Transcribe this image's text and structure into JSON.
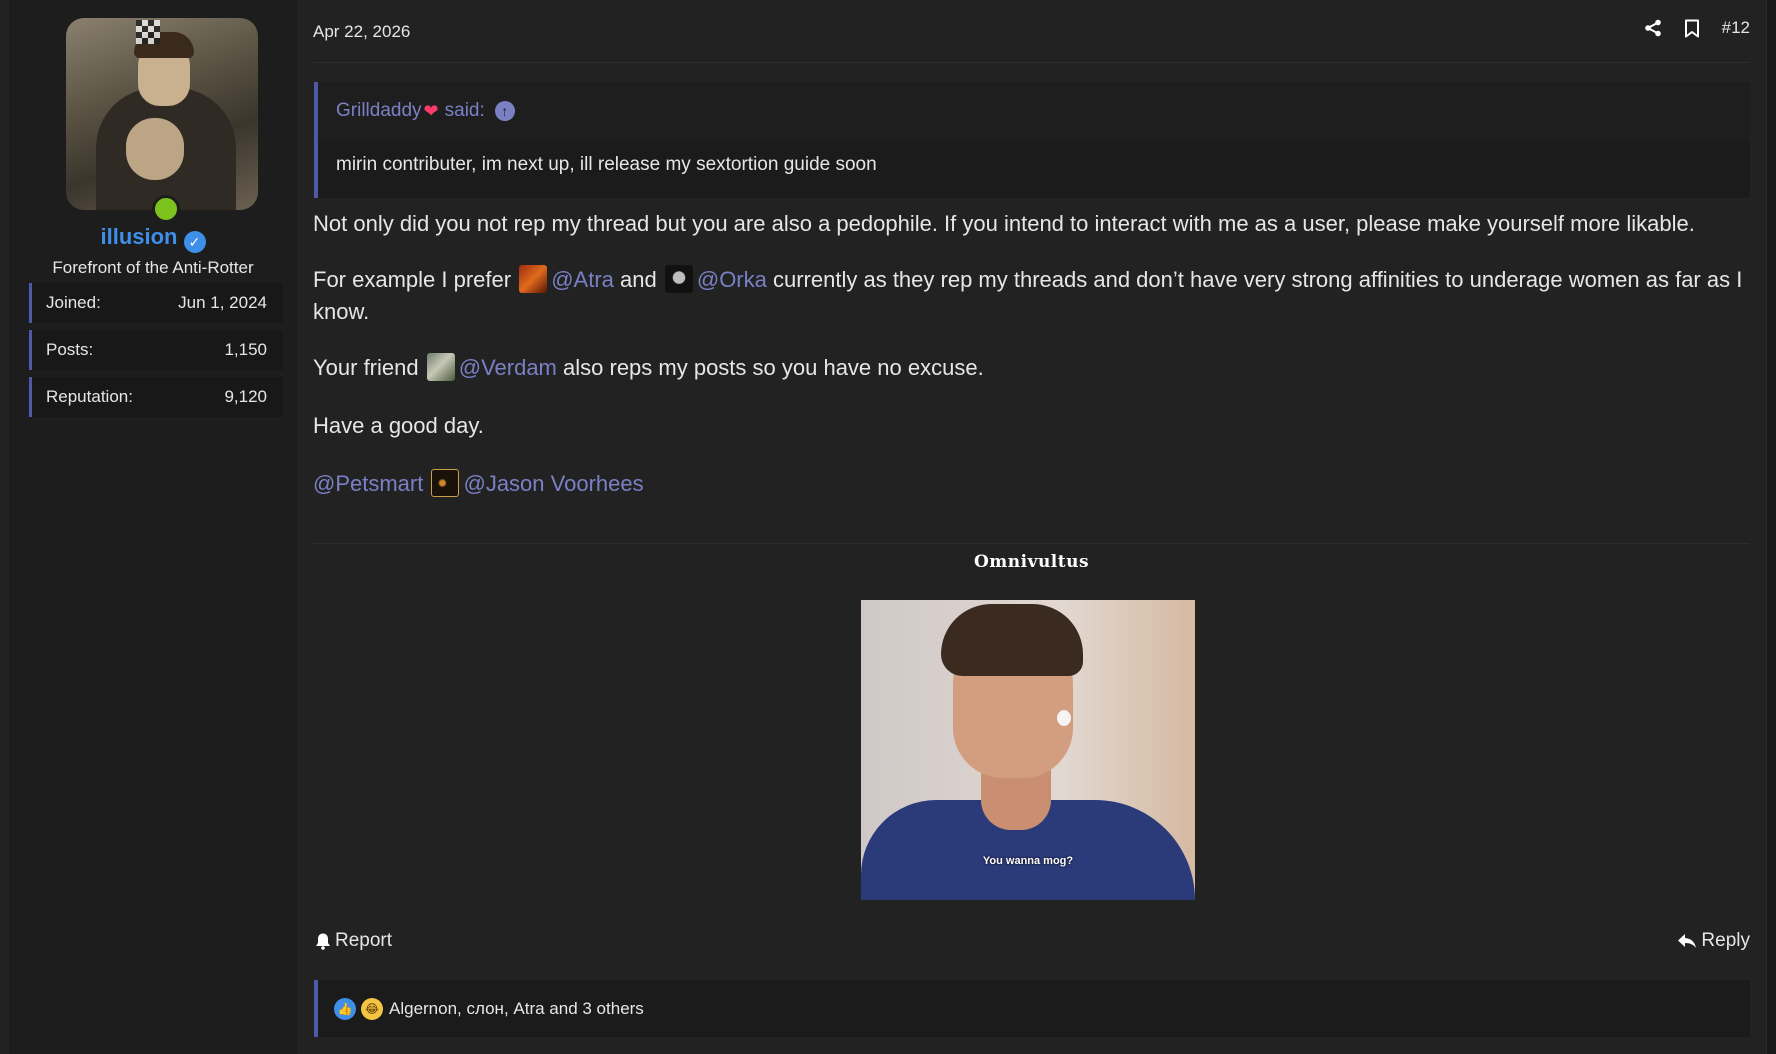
{
  "user": {
    "name": "illusion",
    "title": "Forefront of the Anti-Rotter Movement",
    "status": "online",
    "stats": [
      {
        "label": "Joined:",
        "value": "Jun 1, 2024"
      },
      {
        "label": "Posts:",
        "value": "1,150"
      },
      {
        "label": "Reputation:",
        "value": "9,120"
      }
    ]
  },
  "post": {
    "date": "Apr 22, 2026",
    "number": "#12",
    "quote": {
      "author": "Grilldaddy",
      "said_label": "said:",
      "text": "mirin contributer, im next up, ill release my sextortion guide soon"
    },
    "paragraph1": "Not only did you not rep my thread but you are also a pedophile. If you intend to interact with me as a user, please make yourself more likable.",
    "paragraph2": {
      "part1": "For example I prefer",
      "mention1": "@Atra",
      "part2": "and",
      "mention2": "@Orka",
      "part3": "currently as they rep my threads and don’t have very strong affinities to underage women as far as I know."
    },
    "paragraph3": {
      "part1": "Your friend",
      "mention": "@Verdam",
      "part2": "also reps my posts so you have no excuse."
    },
    "paragraph4": "Have a good day.",
    "mentions_line": {
      "mention1": "@Petsmart",
      "mention2": "@Jason Voorhees"
    },
    "signature": {
      "name": "Omnivultus",
      "caption": "You wanna mog?"
    },
    "actions": {
      "report": "Report",
      "reply": "Reply"
    },
    "reactions_text": "Algernon, слон, Atra and 3 others"
  },
  "colors": {
    "accent": "#4e5aa8",
    "mention": "#7a80c4",
    "username": "#3d8fe8",
    "online": "#7dc31e"
  }
}
